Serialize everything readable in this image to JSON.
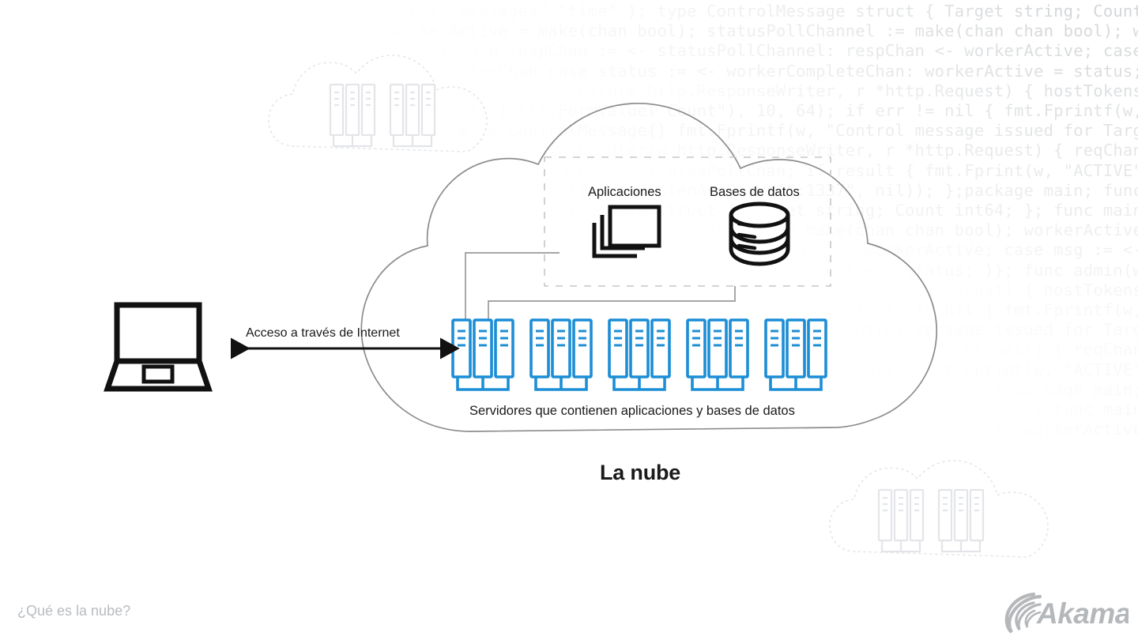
{
  "diagram": {
    "title": "La nube",
    "labels": {
      "applications": "Aplicaciones",
      "databases": "Bases de datos",
      "internet_access": "Acceso a través de Internet",
      "servers_caption": "Servidores que contienen aplicaciones y bases de datos",
      "cloud_title": "La nube"
    },
    "icons": {
      "laptop": "laptop-icon",
      "applications": "stacked-windows-icon",
      "databases": "database-cylinder-icon",
      "server": "server-rack-icon",
      "arrow": "double-headed-arrow-icon",
      "cloud": "cloud-outline-icon",
      "ghost_cloud": "dotted-cloud-icon"
    },
    "counts": {
      "server_groups": 5,
      "racks_per_group": 3,
      "rack_indicator_lines": 3,
      "ghost_cloud_groups": 2
    },
    "colors": {
      "server_blue": "#1c8ed6",
      "server_blue_light": "#4aa8e0",
      "icon_black": "#111111",
      "cloud_outline": "#8c8c8c",
      "connector_gray": "#9a9a9a",
      "dashed_box": "#c9c9c9",
      "ghost_gray": "#e8eaed",
      "code_text": "#9aa0a6",
      "footer_text": "#b8bcc0",
      "logo_gray": "#b5b8bb",
      "background": "#ffffff"
    }
  },
  "footer": {
    "caption": "¿Qué es la nube?",
    "brand": "Akamai"
  },
  "background_code": {
    "language": "Go",
    "lines": [
      "const \"messages\" \"time\" ); type ControlMessage struct { Target string; Count",
      "reqChan workerActive = make(chan bool); statusPollChannel := make(chan chan bool); w",
      "select { case respChan := <- statusPollChannel: respChan <- workerActive; case",
      "msg := <- reqChan case status := <- workerCompleteChan: workerActive = status;",
      "func admin(w http.ResponseWriter, r *http.Request) { hostTokens",
      "strconv.ParseInt(r.FormValue(\"Count\"), 10, 64); if err != nil { fmt.Fprintf(w,",
      "return; } cm := ControlMessage{} fmt.Fprintf(w, \"Control message issued for Targ",
      "func statusHandler(w http.ResponseWriter, r *http.Request) { reqChan",
      "reqChan <- statusPollChan; if result { fmt.Fprint(w, \"ACTIVE\"",
      "log.Fatal(http.ListenAndServe(\":1337\", nil)); };package main; func",
      "type ControlMessage struct { Target string; Count int64; }; func main",
      "workerActive := make(chan chan bool); workerActive",
      "respChan <- workerActive; case msg := <-",
      "workerActive = status; )}; func admin(w",
      "http.Request) { hostTokens",
      "10, 64); if err != nil { fmt.Fprintf(w,",
      "fmt.Fprintf(w, \"Control message issued for Targ",
      "r *http.Request) { reqChan",
      "if result { fmt.Fprint(w, \"ACTIVE\"",
      "nil)); };package main;",
      "int64; ); func main",
      "chan bool); workerActive"
    ]
  }
}
